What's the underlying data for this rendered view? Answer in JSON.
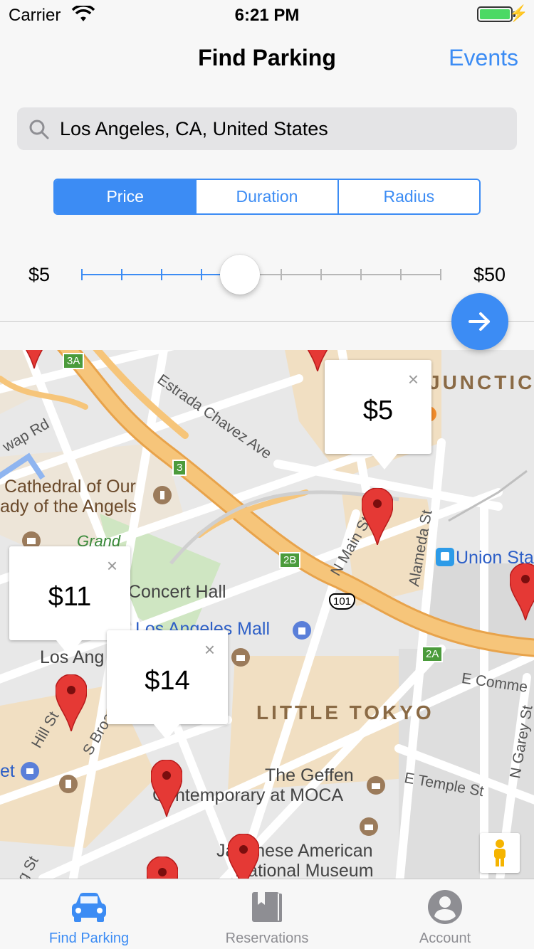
{
  "status_bar": {
    "carrier": "Carrier",
    "time": "6:21 PM"
  },
  "nav": {
    "title": "Find Parking",
    "right_button": "Events"
  },
  "search": {
    "value": "Los Angeles, CA, United States",
    "icon": "search-icon"
  },
  "filter_tabs": [
    {
      "label": "Price",
      "active": true
    },
    {
      "label": "Duration",
      "active": false
    },
    {
      "label": "Radius",
      "active": false
    }
  ],
  "slider": {
    "min_label": "$5",
    "max_label": "$50",
    "value_fraction": 0.44
  },
  "map": {
    "labels": {
      "junction": "JUNCTIC",
      "estrada": "Estrada Chavez Ave",
      "swap_rd": "wap Rd",
      "cathedral_1": "Cathedral of Our",
      "cathedral_2": "ady of the Angels",
      "grand": "Grand",
      "concert_hall": "Concert Hall",
      "la_mall": "Los Angeles Mall",
      "los_ang": "Los Ang",
      "little_tokyo": "LITTLE TOKYO",
      "union_station": "Union Statio",
      "n_main_st": "N Main St",
      "alameda_st": "Alameda St",
      "e_comme": "E Comme",
      "n_garey_st": "N Garey St",
      "e_temple_st": "E Temple St",
      "geffen_1": "The Geffen",
      "geffen_2": "Contemporary at MOCA",
      "jam_1": "Japanese American",
      "jam_2": "National Museum",
      "hill_st": "Hill St",
      "s_broad": "S Broa",
      "et": "et",
      "g_st": "g St"
    },
    "shields": {
      "s3a": "3A",
      "s3": "3",
      "s2b": "2B",
      "s101": "101",
      "s2a": "2A"
    },
    "price_callouts": [
      {
        "price": "$5"
      },
      {
        "price": "$11"
      },
      {
        "price": "$14"
      }
    ],
    "close_glyph": "×"
  },
  "tabbar": [
    {
      "label": "Find Parking",
      "icon": "car-icon",
      "active": true
    },
    {
      "label": "Reservations",
      "icon": "book-icon",
      "active": false
    },
    {
      "label": "Account",
      "icon": "account-icon",
      "active": false
    }
  ],
  "colors": {
    "accent": "#3c8cf4",
    "pin": "#e53935",
    "highway": "#f5b95d"
  }
}
